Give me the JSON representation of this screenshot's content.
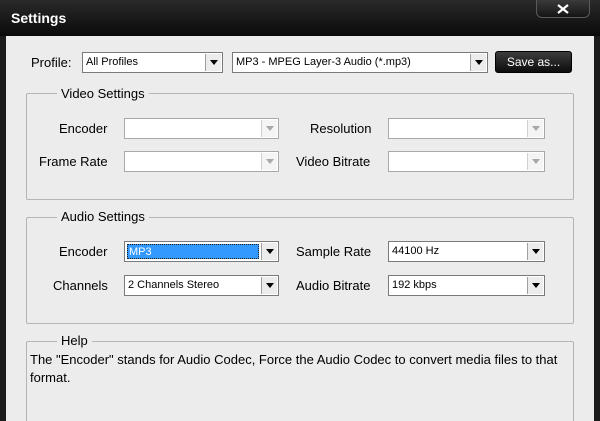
{
  "window": {
    "title": "Settings",
    "close_icon": "close-icon"
  },
  "profile": {
    "label": "Profile:",
    "category_value": "All Profiles",
    "format_value": "MP3 - MPEG Layer-3 Audio (*.mp3)",
    "save_as_label": "Save as..."
  },
  "video_settings": {
    "title": "Video Settings",
    "encoder_label": "Encoder",
    "encoder_value": "",
    "resolution_label": "Resolution",
    "resolution_value": "",
    "frame_rate_label": "Frame Rate",
    "frame_rate_value": "",
    "video_bitrate_label": "Video Bitrate",
    "video_bitrate_value": ""
  },
  "audio_settings": {
    "title": "Audio Settings",
    "encoder_label": "Encoder",
    "encoder_value": "MP3",
    "sample_rate_label": "Sample Rate",
    "sample_rate_value": "44100 Hz",
    "channels_label": "Channels",
    "channels_value": "2 Channels Stereo",
    "audio_bitrate_label": "Audio Bitrate",
    "audio_bitrate_value": "192 kbps"
  },
  "help": {
    "title": "Help",
    "text": "The \"Encoder\" stands for Audio Codec, Force the Audio Codec to convert media files to that format."
  },
  "colors": {
    "titlebar": "#0a0a0a",
    "client": "#ececec",
    "selection": "#3399ff"
  }
}
